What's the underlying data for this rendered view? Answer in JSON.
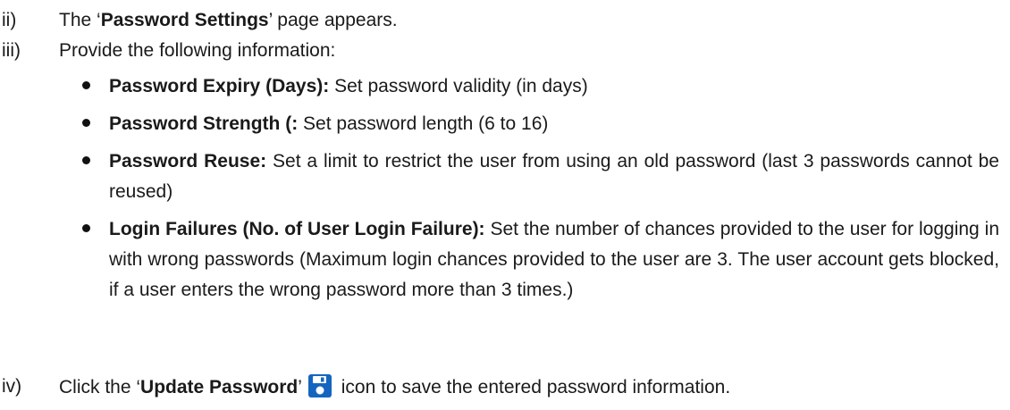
{
  "steps": {
    "ii": {
      "num": "ii)",
      "pre": "The ‘",
      "bold": "Password Settings",
      "post": "’ page appears."
    },
    "iii": {
      "num": "iii)",
      "text": "Provide the following information:"
    },
    "iv": {
      "num": "iv)",
      "pre": "Click the ‘",
      "bold": "Update Password",
      "mid": "’",
      "post": " icon to save the entered password information."
    }
  },
  "bullets": [
    {
      "label": "Password Expiry (Days):",
      "desc": " Set password validity (in days)"
    },
    {
      "label": "Password Strength (:",
      "desc": " Set password length (6 to 16)"
    },
    {
      "label": "Password Reuse:",
      "desc": " Set a limit to restrict the user from using an old password (last 3 passwords cannot be reused)"
    },
    {
      "label": "Login Failures (No. of User Login Failure):",
      "desc": " Set the number of chances provided to the user for logging in with wrong passwords (Maximum login chances provided to the user are 3. The user account gets blocked, if a user enters the wrong password more than 3 times.)"
    }
  ],
  "icons": {
    "update_password": "save-icon",
    "accent": "#1565c0"
  }
}
